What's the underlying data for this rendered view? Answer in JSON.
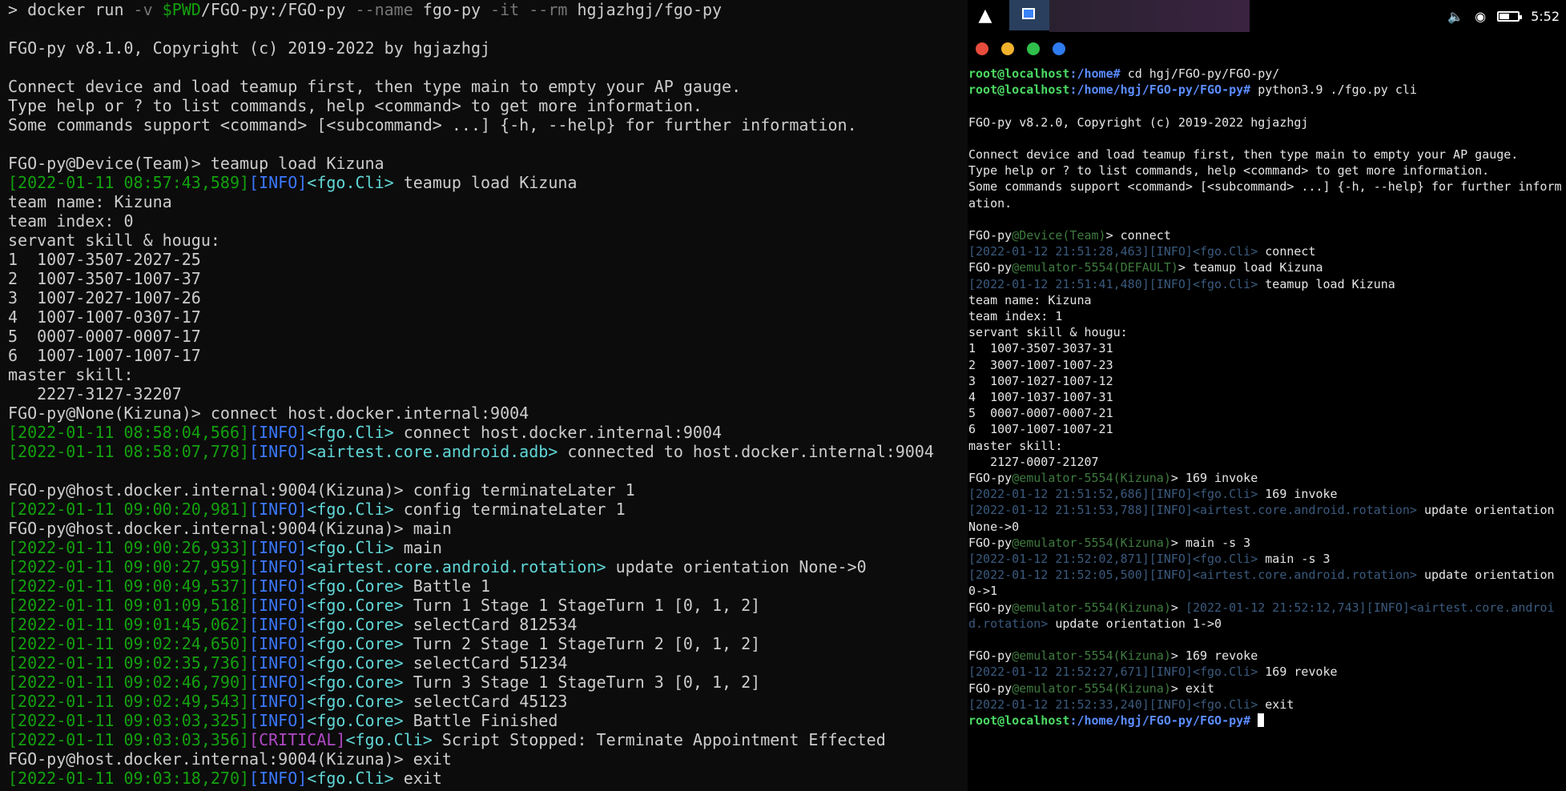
{
  "left_terminal": {
    "lines": [
      [
        {
          "t": "> docker run ",
          "c": ""
        },
        {
          "t": "-v ",
          "c": "dim"
        },
        {
          "t": "$PWD",
          "c": "g"
        },
        {
          "t": "/FGO-py:/FGO-py ",
          "c": ""
        },
        {
          "t": "--name ",
          "c": "dim"
        },
        {
          "t": "fgo-py ",
          "c": ""
        },
        {
          "t": "-it --rm ",
          "c": "dim"
        },
        {
          "t": "hgjazhgj/fgo-py",
          "c": ""
        }
      ],
      [],
      [
        {
          "t": "FGO-py v8.1.0, Copyright (c) 2019-2022 by hgjazhgj",
          "c": ""
        }
      ],
      [],
      [
        {
          "t": "Connect device and load teamup first, then type main to empty your AP gauge.",
          "c": ""
        }
      ],
      [
        {
          "t": "Type help or ? to list commands, help <command> to get more information.",
          "c": ""
        }
      ],
      [
        {
          "t": "Some commands support <command> [<subcommand> ...] {-h, --help} for further information.",
          "c": ""
        }
      ],
      [],
      [
        {
          "t": "FGO-py@Device(Team)> teamup load Kizuna",
          "c": ""
        }
      ],
      [
        {
          "t": "[2022-01-11 08:57:43,589]",
          "c": "g"
        },
        {
          "t": "[INFO]",
          "c": "b"
        },
        {
          "t": "<fgo.Cli>",
          "c": "cy"
        },
        {
          "t": " teamup load Kizuna",
          "c": ""
        }
      ],
      [
        {
          "t": "team name: Kizuna",
          "c": ""
        }
      ],
      [
        {
          "t": "team index: 0",
          "c": ""
        }
      ],
      [
        {
          "t": "servant skill & hougu:",
          "c": ""
        }
      ],
      [
        {
          "t": "1  1007-3507-2027-25",
          "c": ""
        }
      ],
      [
        {
          "t": "2  1007-3507-1007-37",
          "c": ""
        }
      ],
      [
        {
          "t": "3  1007-2027-1007-26",
          "c": ""
        }
      ],
      [
        {
          "t": "4  1007-1007-0307-17",
          "c": ""
        }
      ],
      [
        {
          "t": "5  0007-0007-0007-17",
          "c": ""
        }
      ],
      [
        {
          "t": "6  1007-1007-1007-17",
          "c": ""
        }
      ],
      [
        {
          "t": "master skill:",
          "c": ""
        }
      ],
      [
        {
          "t": "   2227-3127-32207",
          "c": ""
        }
      ],
      [
        {
          "t": "FGO-py@None(Kizuna)> connect host.docker.internal:9004",
          "c": ""
        }
      ],
      [
        {
          "t": "[2022-01-11 08:58:04,566]",
          "c": "g"
        },
        {
          "t": "[INFO]",
          "c": "b"
        },
        {
          "t": "<fgo.Cli>",
          "c": "cy"
        },
        {
          "t": " connect host.docker.internal:9004",
          "c": ""
        }
      ],
      [
        {
          "t": "[2022-01-11 08:58:07,778]",
          "c": "g"
        },
        {
          "t": "[INFO]",
          "c": "b"
        },
        {
          "t": "<airtest.core.android.adb>",
          "c": "cy"
        },
        {
          "t": " connected to host.docker.internal:9004",
          "c": ""
        }
      ],
      [],
      [
        {
          "t": "FGO-py@host.docker.internal:9004(Kizuna)> config terminateLater 1",
          "c": ""
        }
      ],
      [
        {
          "t": "[2022-01-11 09:00:20,981]",
          "c": "g"
        },
        {
          "t": "[INFO]",
          "c": "b"
        },
        {
          "t": "<fgo.Cli>",
          "c": "cy"
        },
        {
          "t": " config terminateLater 1",
          "c": ""
        }
      ],
      [
        {
          "t": "FGO-py@host.docker.internal:9004(Kizuna)> main",
          "c": ""
        }
      ],
      [
        {
          "t": "[2022-01-11 09:00:26,933]",
          "c": "g"
        },
        {
          "t": "[INFO]",
          "c": "b"
        },
        {
          "t": "<fgo.Cli>",
          "c": "cy"
        },
        {
          "t": " main",
          "c": ""
        }
      ],
      [
        {
          "t": "[2022-01-11 09:00:27,959]",
          "c": "g"
        },
        {
          "t": "[INFO]",
          "c": "b"
        },
        {
          "t": "<airtest.core.android.rotation>",
          "c": "cy"
        },
        {
          "t": " update orientation None->0",
          "c": ""
        }
      ],
      [
        {
          "t": "[2022-01-11 09:00:49,537]",
          "c": "g"
        },
        {
          "t": "[INFO]",
          "c": "b"
        },
        {
          "t": "<fgo.Core>",
          "c": "cy"
        },
        {
          "t": " Battle 1",
          "c": ""
        }
      ],
      [
        {
          "t": "[2022-01-11 09:01:09,518]",
          "c": "g"
        },
        {
          "t": "[INFO]",
          "c": "b"
        },
        {
          "t": "<fgo.Core>",
          "c": "cy"
        },
        {
          "t": " Turn 1 Stage 1 StageTurn 1 [0, 1, 2]",
          "c": ""
        }
      ],
      [
        {
          "t": "[2022-01-11 09:01:45,062]",
          "c": "g"
        },
        {
          "t": "[INFO]",
          "c": "b"
        },
        {
          "t": "<fgo.Core>",
          "c": "cy"
        },
        {
          "t": " selectCard 812534",
          "c": ""
        }
      ],
      [
        {
          "t": "[2022-01-11 09:02:24,650]",
          "c": "g"
        },
        {
          "t": "[INFO]",
          "c": "b"
        },
        {
          "t": "<fgo.Core>",
          "c": "cy"
        },
        {
          "t": " Turn 2 Stage 1 StageTurn 2 [0, 1, 2]",
          "c": ""
        }
      ],
      [
        {
          "t": "[2022-01-11 09:02:35,736]",
          "c": "g"
        },
        {
          "t": "[INFO]",
          "c": "b"
        },
        {
          "t": "<fgo.Core>",
          "c": "cy"
        },
        {
          "t": " selectCard 51234",
          "c": ""
        }
      ],
      [
        {
          "t": "[2022-01-11 09:02:46,790]",
          "c": "g"
        },
        {
          "t": "[INFO]",
          "c": "b"
        },
        {
          "t": "<fgo.Core>",
          "c": "cy"
        },
        {
          "t": " Turn 3 Stage 1 StageTurn 3 [0, 1, 2]",
          "c": ""
        }
      ],
      [
        {
          "t": "[2022-01-11 09:02:49,543]",
          "c": "g"
        },
        {
          "t": "[INFO]",
          "c": "b"
        },
        {
          "t": "<fgo.Core>",
          "c": "cy"
        },
        {
          "t": " selectCard 45123",
          "c": ""
        }
      ],
      [
        {
          "t": "[2022-01-11 09:03:03,325]",
          "c": "g"
        },
        {
          "t": "[INFO]",
          "c": "b"
        },
        {
          "t": "<fgo.Core>",
          "c": "cy"
        },
        {
          "t": " Battle Finished",
          "c": ""
        }
      ],
      [
        {
          "t": "[2022-01-11 09:03:03,356]",
          "c": "g"
        },
        {
          "t": "[CRITICAL]",
          "c": "m"
        },
        {
          "t": "<fgo.Cli>",
          "c": "cy"
        },
        {
          "t": " Script Stopped: Terminate Appointment Effected",
          "c": ""
        }
      ],
      [
        {
          "t": "FGO-py@host.docker.internal:9004(Kizuna)> exit",
          "c": ""
        }
      ],
      [
        {
          "t": "[2022-01-11 09:03:18,270]",
          "c": "g"
        },
        {
          "t": "[INFO]",
          "c": "b"
        },
        {
          "t": "<fgo.Cli>",
          "c": "cy"
        },
        {
          "t": " exit",
          "c": ""
        }
      ]
    ]
  },
  "taskbar": {
    "launcher_icon": "launcher-icon",
    "time": "5:52",
    "battery_level": 0.55
  },
  "window_controls": [
    "#e74c3c",
    "#f1b32c",
    "#2fbf4a",
    "#2f7bf0"
  ],
  "right_terminal": {
    "lines": [
      [
        {
          "t": "root@localhost",
          "c": "r-g"
        },
        {
          "t": ":/home# ",
          "c": "r-b"
        },
        {
          "t": "cd hgj/FGO-py/FGO-py/",
          "c": ""
        }
      ],
      [
        {
          "t": "root@localhost",
          "c": "r-g"
        },
        {
          "t": ":/home/hgj/FGO-py/FGO-py# ",
          "c": "r-b"
        },
        {
          "t": "python3.9 ./fgo.py cli",
          "c": ""
        }
      ],
      [],
      [
        {
          "t": "FGO-py v8.2.0, Copyright (c) 2019-2022 hgjazhgj",
          "c": ""
        }
      ],
      [],
      [
        {
          "t": "Connect device and load teamup first, then type main to empty your AP gauge.",
          "c": ""
        }
      ],
      [
        {
          "t": "Type help or ? to list commands, help <command> to get more information.",
          "c": ""
        }
      ],
      [
        {
          "t": "Some commands support <command> [<subcommand> ...] {-h, --help} for further information.",
          "c": ""
        }
      ],
      [],
      [
        {
          "t": "FGO-py",
          "c": ""
        },
        {
          "t": "@Device(Team)",
          "c": "r-dg"
        },
        {
          "t": "> connect",
          "c": ""
        }
      ],
      [
        {
          "t": "[2022-01-12 21:51:28,463][INFO]<fgo.Cli>",
          "c": "r-db"
        },
        {
          "t": " connect",
          "c": ""
        }
      ],
      [
        {
          "t": "FGO-py",
          "c": ""
        },
        {
          "t": "@emulator-5554(DEFAULT)",
          "c": "r-dg"
        },
        {
          "t": "> teamup load Kizuna",
          "c": ""
        }
      ],
      [
        {
          "t": "[2022-01-12 21:51:41,480][INFO]<fgo.Cli>",
          "c": "r-db"
        },
        {
          "t": " teamup load Kizuna",
          "c": ""
        }
      ],
      [
        {
          "t": "team name: Kizuna",
          "c": ""
        }
      ],
      [
        {
          "t": "team index: 1",
          "c": ""
        }
      ],
      [
        {
          "t": "servant skill & hougu:",
          "c": ""
        }
      ],
      [
        {
          "t": "1  1007-3507-3037-31",
          "c": ""
        }
      ],
      [
        {
          "t": "2  3007-1007-1007-23",
          "c": ""
        }
      ],
      [
        {
          "t": "3  1007-1027-1007-12",
          "c": ""
        }
      ],
      [
        {
          "t": "4  1007-1037-1007-31",
          "c": ""
        }
      ],
      [
        {
          "t": "5  0007-0007-0007-21",
          "c": ""
        }
      ],
      [
        {
          "t": "6  1007-1007-1007-21",
          "c": ""
        }
      ],
      [
        {
          "t": "master skill:",
          "c": ""
        }
      ],
      [
        {
          "t": "   2127-0007-21207",
          "c": ""
        }
      ],
      [
        {
          "t": "FGO-py",
          "c": ""
        },
        {
          "t": "@emulator-5554(Kizuna)",
          "c": "r-dg"
        },
        {
          "t": "> 169 invoke",
          "c": ""
        }
      ],
      [
        {
          "t": "[2022-01-12 21:51:52,686][INFO]<fgo.Cli>",
          "c": "r-db"
        },
        {
          "t": " 169 invoke",
          "c": ""
        }
      ],
      [
        {
          "t": "[2022-01-12 21:51:53,788][INFO]<airtest.core.android.rotation>",
          "c": "r-db"
        },
        {
          "t": " update orientation None->0",
          "c": ""
        }
      ],
      [
        {
          "t": "FGO-py",
          "c": ""
        },
        {
          "t": "@emulator-5554(Kizuna)",
          "c": "r-dg"
        },
        {
          "t": "> main -s 3",
          "c": ""
        }
      ],
      [
        {
          "t": "[2022-01-12 21:52:02,871][INFO]<fgo.Cli>",
          "c": "r-db"
        },
        {
          "t": " main -s 3",
          "c": ""
        }
      ],
      [
        {
          "t": "[2022-01-12 21:52:05,500][INFO]<airtest.core.android.rotation>",
          "c": "r-db"
        },
        {
          "t": " update orientation 0->1",
          "c": ""
        }
      ],
      [
        {
          "t": "FGO-py",
          "c": ""
        },
        {
          "t": "@emulator-5554(Kizuna)",
          "c": "r-dg"
        },
        {
          "t": "> ",
          "c": ""
        },
        {
          "t": "[2022-01-12 21:52:12,743][INFO]<airtest.core.android.rotation>",
          "c": "r-db"
        },
        {
          "t": " update orientation 1->0",
          "c": ""
        }
      ],
      [],
      [
        {
          "t": "FGO-py",
          "c": ""
        },
        {
          "t": "@emulator-5554(Kizuna)",
          "c": "r-dg"
        },
        {
          "t": "> 169 revoke",
          "c": ""
        }
      ],
      [
        {
          "t": "[2022-01-12 21:52:27,671][INFO]<fgo.Cli>",
          "c": "r-db"
        },
        {
          "t": " 169 revoke",
          "c": ""
        }
      ],
      [
        {
          "t": "FGO-py",
          "c": ""
        },
        {
          "t": "@emulator-5554(Kizuna)",
          "c": "r-dg"
        },
        {
          "t": "> exit",
          "c": ""
        }
      ],
      [
        {
          "t": "[2022-01-12 21:52:33,240][INFO]<fgo.Cli>",
          "c": "r-db"
        },
        {
          "t": " exit",
          "c": ""
        }
      ],
      [
        {
          "t": "root@localhost",
          "c": "r-g"
        },
        {
          "t": ":/home/hgj/FGO-py/FGO-py# ",
          "c": "r-b"
        },
        {
          "t": "",
          "c": "cursor"
        }
      ]
    ]
  }
}
